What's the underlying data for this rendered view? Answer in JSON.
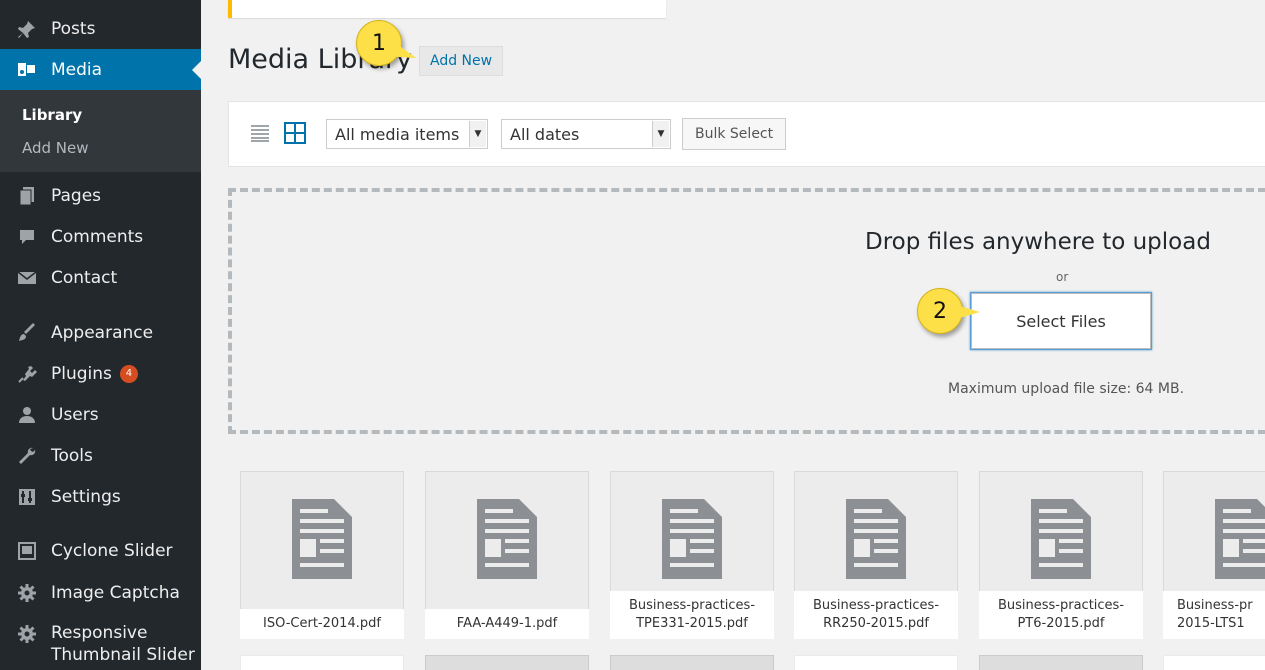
{
  "sidebar": {
    "items": [
      {
        "label": "Posts",
        "icon": "pin-icon"
      },
      {
        "label": "Media",
        "icon": "media-icon"
      },
      {
        "label": "Pages",
        "icon": "pages-icon"
      },
      {
        "label": "Comments",
        "icon": "comments-icon"
      },
      {
        "label": "Contact",
        "icon": "mail-icon"
      },
      {
        "label": "Appearance",
        "icon": "brush-icon"
      },
      {
        "label": "Plugins",
        "icon": "plugin-icon",
        "badge": "4"
      },
      {
        "label": "Users",
        "icon": "users-icon"
      },
      {
        "label": "Tools",
        "icon": "wrench-icon"
      },
      {
        "label": "Settings",
        "icon": "settings-icon"
      },
      {
        "label": "Cyclone Slider",
        "icon": "slider-icon"
      },
      {
        "label": "Image Captcha",
        "icon": "gear-icon"
      },
      {
        "label": "Responsive Thumbnail Slider",
        "label_line1": "Responsive",
        "label_line2": "Thumbnail Slider",
        "icon": "gear-icon"
      }
    ],
    "submenu": {
      "library": "Library",
      "add_new": "Add New"
    },
    "colors": {
      "bg": "#23282d",
      "active": "#0073aa",
      "badge": "#d54e21"
    }
  },
  "header": {
    "title": "Media Library",
    "add_new": "Add New"
  },
  "callouts": {
    "one": "1",
    "two": "2"
  },
  "toolbar": {
    "filter_type": "All media items",
    "filter_date": "All dates",
    "bulk_select": "Bulk Select"
  },
  "uploader": {
    "drop_text": "Drop files anywhere to upload",
    "or": "or",
    "select_files": "Select Files",
    "max_size": "Maximum upload file size: 64 MB."
  },
  "files": [
    {
      "line1": "ISO-Cert-2014.pdf",
      "line2": ""
    },
    {
      "line1": "FAA-A449-1.pdf",
      "line2": ""
    },
    {
      "line1": "Business-practices-",
      "line2": "TPE331-2015.pdf"
    },
    {
      "line1": "Business-practices-",
      "line2": "RR250-2015.pdf"
    },
    {
      "line1": "Business-practices-",
      "line2": "PT6-2015.pdf"
    },
    {
      "line1": "Business-pr",
      "line2": "2015-LTS1"
    }
  ]
}
